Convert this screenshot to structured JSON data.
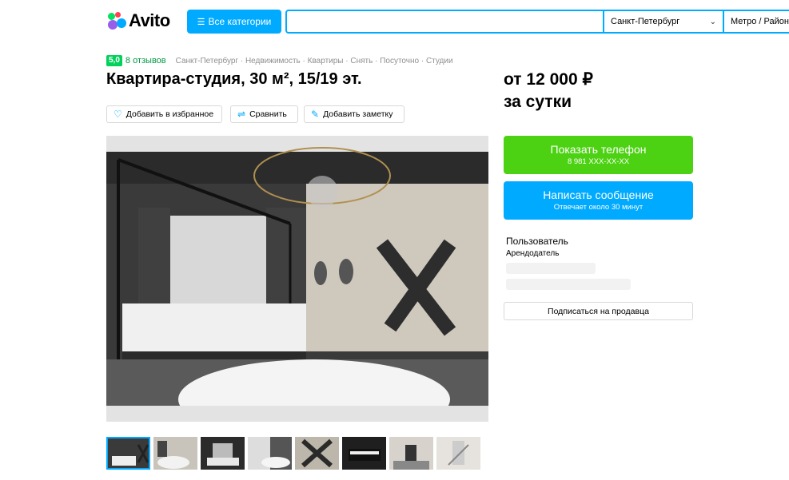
{
  "header": {
    "logo_text": "Avito",
    "categories_label": "Все категории",
    "search_placeholder": "",
    "city_value": "Санкт-Петербург",
    "metro_label": "Метро / Район",
    "accent_color": "#00aaff"
  },
  "rating": {
    "score": "5,0",
    "reviews": "8 отзывов"
  },
  "breadcrumbs": [
    "Санкт-Петербург",
    "Недвижимость",
    "Квартиры",
    "Снять",
    "Посуточно",
    "Студии"
  ],
  "breadcrumbs_text": "Санкт-Петербург · Недвижимость · Квартиры · Снять · Посуточно · Студии",
  "listing": {
    "title": "Квартира-студия, 30 м², 15/19 эт.",
    "price_line1": "от 12 000 ₽",
    "price_line2": "за сутки"
  },
  "actions": {
    "favorite_label": "Добавить в избранное",
    "compare_label": "Сравнить",
    "note_label": "Добавить заметку"
  },
  "contact": {
    "phone_label": "Показать телефон",
    "phone_masked": "8 981 XXX-XX-XX",
    "phone_color": "#4cd213",
    "message_label": "Написать сообщение",
    "message_sub": "Отвечает около 30 минут",
    "message_color": "#00aaff"
  },
  "seller": {
    "name": "Пользователь",
    "role": "Арендодатель",
    "subscribe_label": "Подписаться на продавца"
  },
  "gallery": {
    "thumbnail_count": 8,
    "selected_index": 0
  }
}
